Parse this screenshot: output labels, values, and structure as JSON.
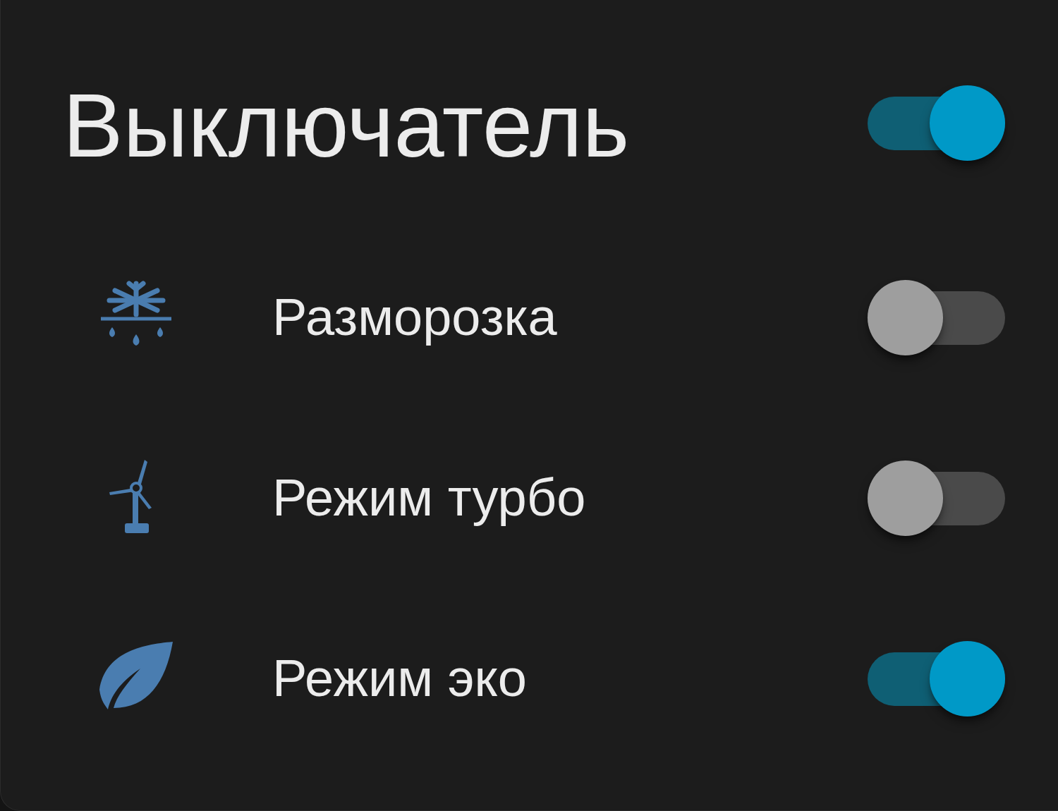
{
  "title": "Выключатель",
  "master": {
    "on": true
  },
  "rows": [
    {
      "kind": "defrost",
      "label": "Разморозка",
      "on": false
    },
    {
      "kind": "turbo",
      "label": "Режим турбо",
      "on": false
    },
    {
      "kind": "eco",
      "label": "Режим эко",
      "on": true
    }
  ]
}
